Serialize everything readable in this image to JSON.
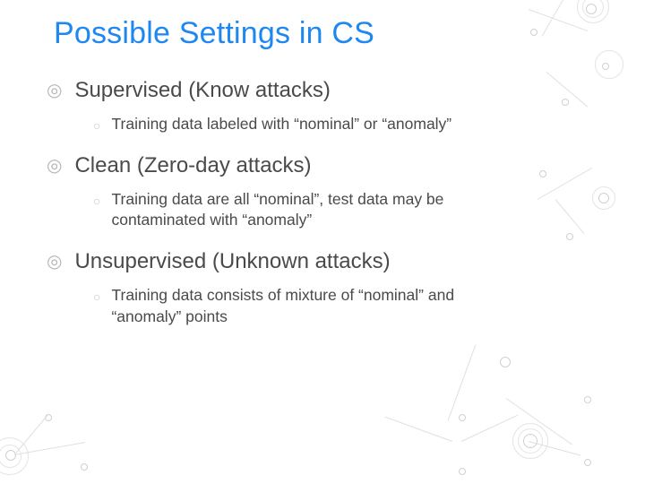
{
  "title": "Possible Settings in CS",
  "bullets": {
    "top": "◎",
    "sub": "○"
  },
  "sections": [
    {
      "heading": "Supervised (Know attacks)",
      "sub": "Training data labeled with “nominal” or “anomaly”"
    },
    {
      "heading": "Clean (Zero-day attacks)",
      "sub": "Training data are all “nominal”, test data may be contaminated with “anomaly”"
    },
    {
      "heading": "Unsupervised (Unknown attacks)",
      "sub": "Training data consists of mixture of “nominal” and “anomaly” points"
    }
  ]
}
